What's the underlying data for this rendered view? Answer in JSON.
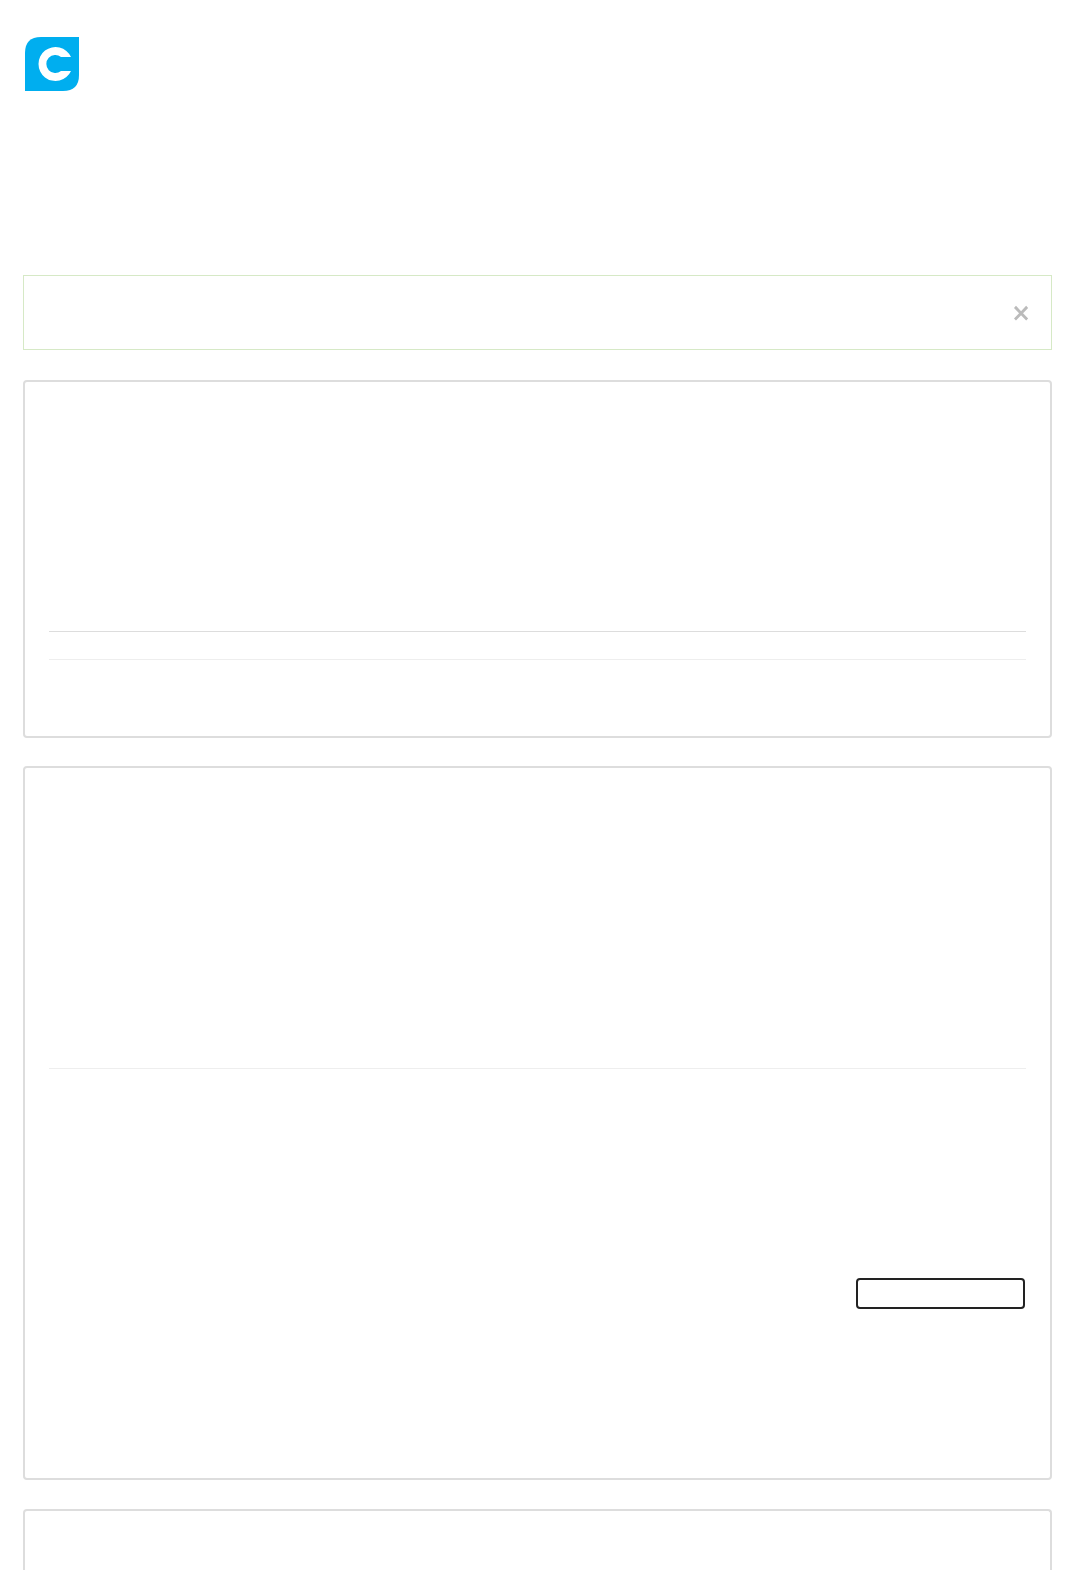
{
  "alert": {
    "close": "×"
  }
}
